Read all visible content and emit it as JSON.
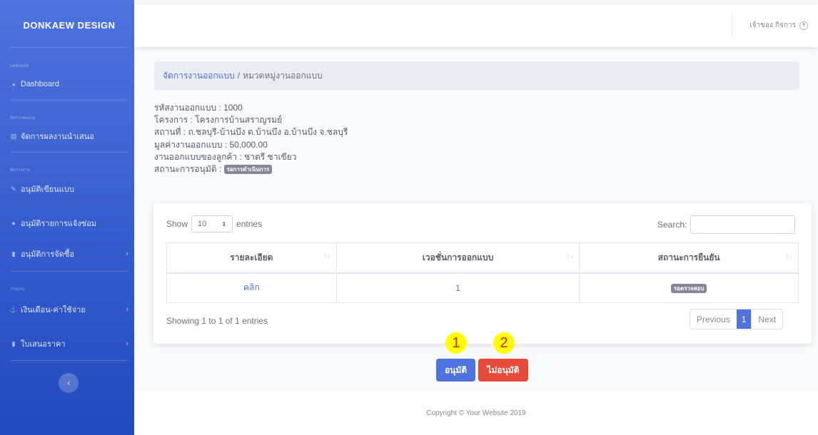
{
  "brand": "DONKAEW DESIGN",
  "colors": {
    "primary": "#4e73df",
    "danger": "#e74a3b",
    "secondary": "#858796",
    "marker": "#ffff00"
  },
  "sidebar": {
    "sections": [
      {
        "heading": "แดชบอร์ด",
        "items": [
          {
            "label": "Dashboard",
            "icon": "dashboard-icon"
          }
        ]
      },
      {
        "heading": "จัดการผลงาน",
        "items": [
          {
            "label": "จัดการผลงานนำเสนอ",
            "icon": "table-icon"
          }
        ]
      },
      {
        "heading": "จัดการงาน",
        "items": [
          {
            "label": "อนุมัติเขียนแบบ",
            "icon": "pencil-icon"
          },
          {
            "label": "อนุมัติรายการแจ้งซ่อม",
            "icon": "chat-icon"
          },
          {
            "label": "อนุมัติการจัดซื้อ",
            "icon": "file-icon",
            "chevron": "›"
          }
        ]
      },
      {
        "heading": "รายงาน",
        "items": [
          {
            "label": "เงินเดือน-ค่าใช้จ่าย",
            "icon": "money-icon",
            "chevron": "›"
          },
          {
            "label": "ใบเสนอราคา",
            "icon": "file-icon",
            "chevron": "›"
          }
        ]
      }
    ],
    "toggle_icon": "‹"
  },
  "topbar": {
    "user_name": "เจ้าของ กิจการ"
  },
  "breadcrumb": {
    "link": "จัดการงานออกแบบ",
    "separator": "/",
    "current": "หมวดหมู่งานออกแบบ"
  },
  "info": {
    "lines": [
      "รหัสงานออกแบบ : 1000",
      "โครงการ : โครงการบ้านสราญรมย์",
      "สถานที่ : ถ.ชลบุรี-บ้านบึง ต.บ้านบึง อ.บ้านบึง จ.ชลบุรี",
      "มูลค่างานออกแบบ : 50,000.00",
      "งานออกแบบของลูกค้า : ชาตรี ชาเขียว"
    ],
    "status_label": "สถานะการอนุมัติ :",
    "status_badge": "รอการดำเนินการ"
  },
  "table": {
    "show_label": "Show",
    "entries_value": "10",
    "entries_label": "entries",
    "search_label": "Search:",
    "columns": [
      "รายละเอียด",
      "เวอชั่นการออกแบบ",
      "สถานะการยืนยัน"
    ],
    "rows": [
      {
        "detail": "คลิก",
        "version": "1",
        "status": "รอตรวจสอบ"
      }
    ],
    "summary": "Showing 1 to 1 of 1 entries",
    "pagination": {
      "previous": "Previous",
      "page": "1",
      "next": "Next"
    }
  },
  "markers": [
    "1",
    "2"
  ],
  "actions": {
    "approve": "อนุมัติ",
    "reject": "ไม่อนุมัติ"
  },
  "footer": "Copyright © Your Website 2019"
}
